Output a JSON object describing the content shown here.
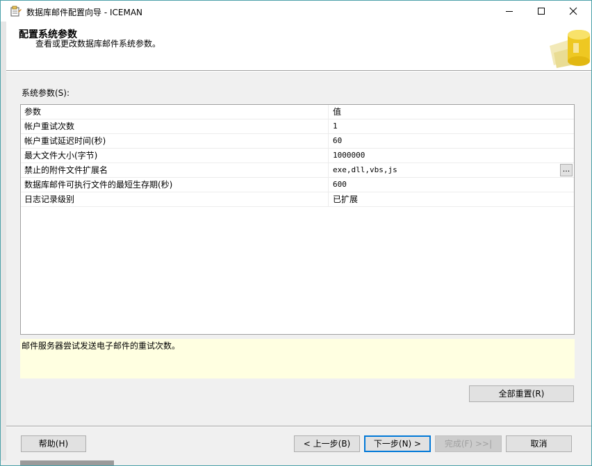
{
  "window": {
    "title": "数据库邮件配置向导 - ICEMAN"
  },
  "header": {
    "title": "配置系统参数",
    "subtitle": "查看或更改数据库邮件系统参数。"
  },
  "grid": {
    "label": "系统参数(S):",
    "columns": [
      "参数",
      "值"
    ],
    "rows": [
      {
        "name": "帐户重试次数",
        "value": "1"
      },
      {
        "name": "帐户重试延迟时间(秒)",
        "value": "60"
      },
      {
        "name": "最大文件大小(字节)",
        "value": "1000000"
      },
      {
        "name": "禁止的附件文件扩展名",
        "value": "exe,dll,vbs,js",
        "button": "..."
      },
      {
        "name": "数据库邮件可执行文件的最短生存期(秒)",
        "value": "600"
      },
      {
        "name": "日志记录级别",
        "value": "已扩展"
      }
    ]
  },
  "description": "邮件服务器尝试发送电子邮件的重试次数。",
  "buttons": {
    "reset_all": "全部重置(R)",
    "help": "帮助(H)",
    "back": "< 上一步(B)",
    "next": "下一步(N) >",
    "finish": "完成(F) >>|",
    "cancel": "取消"
  },
  "colors": {
    "accent": "#0078d7",
    "description_bg": "#ffffe1",
    "window_border": "#4aa0a8"
  }
}
